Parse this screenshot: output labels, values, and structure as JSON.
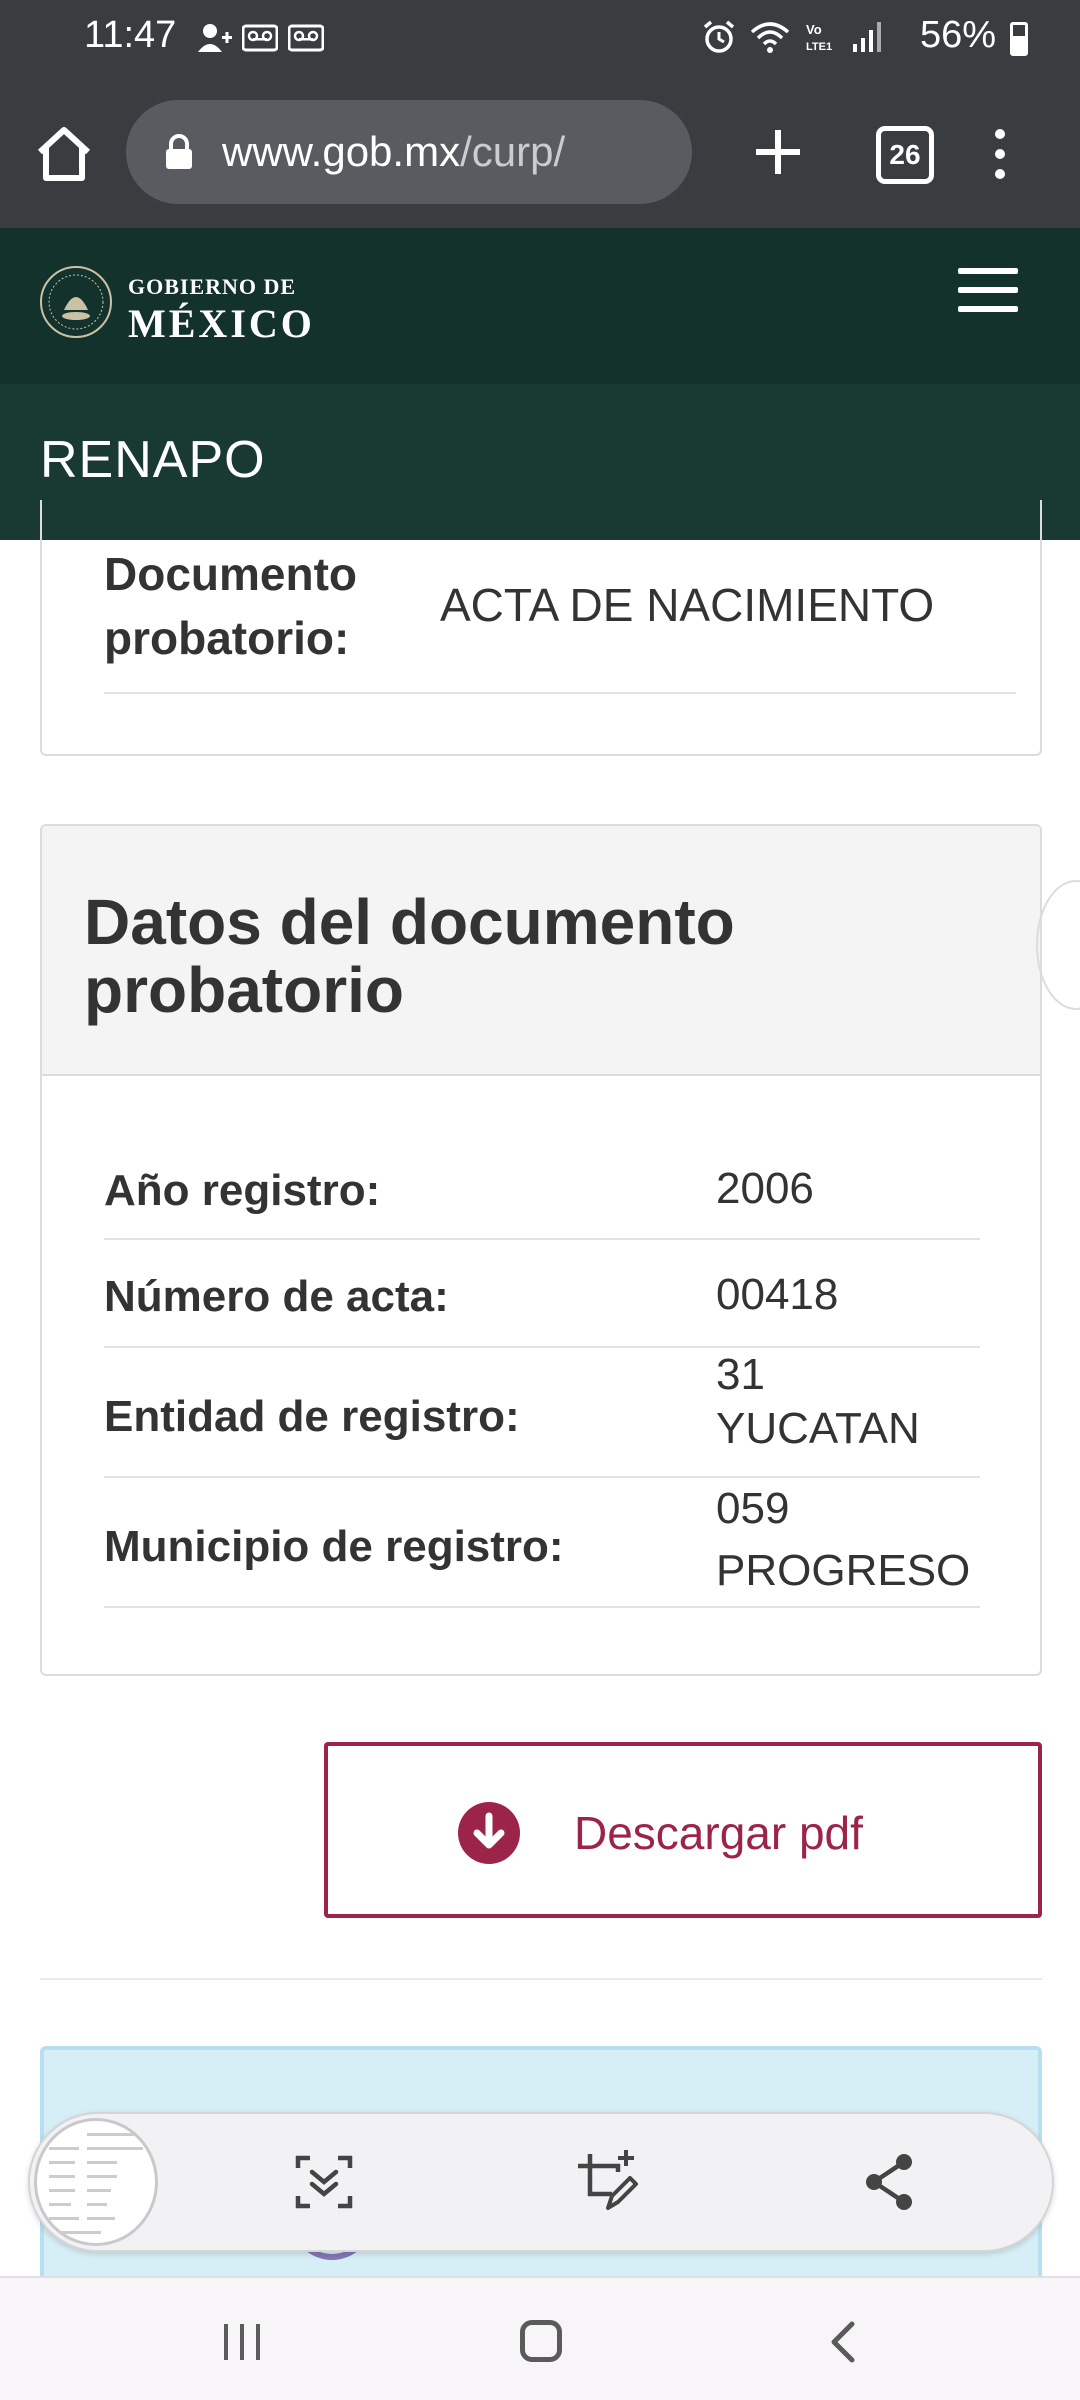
{
  "status_bar": {
    "time": "11:47",
    "battery": "56%",
    "icons": [
      "person-add-icon",
      "voicemail-icon",
      "voicemail-icon",
      "alarm-icon",
      "wifi-icon",
      "volte-icon",
      "signal-icon",
      "battery-icon"
    ]
  },
  "browser": {
    "url_domain": "www.gob.mx",
    "url_path": "/curp/",
    "tab_count": "26"
  },
  "site_header": {
    "logo_small": "GOBIERNO DE",
    "logo_big": "MÉXICO",
    "section": "RENAPO"
  },
  "document": {
    "label": "Documento probatorio:",
    "value": "ACTA DE NACIMIENTO"
  },
  "details": {
    "title": "Datos del documento probatorio",
    "rows": [
      {
        "label": "Año registro:",
        "value": "2006"
      },
      {
        "label": "Número de acta:",
        "value": "00418"
      },
      {
        "label": "Entidad de registro:",
        "value": "31\nYUCATAN"
      },
      {
        "label": "Municipio de registro:",
        "value": "059\nPROGRESO"
      }
    ]
  },
  "download": {
    "label": "Descargar pdf"
  },
  "colors": {
    "brand_dark": "#13322b",
    "brand_green": "#193a33",
    "accent": "#9d2449",
    "info_bg": "#d6eef5"
  },
  "screenshot_toolbar": {
    "tools": [
      "scroll-capture-icon",
      "crop-edit-icon",
      "share-icon"
    ]
  }
}
